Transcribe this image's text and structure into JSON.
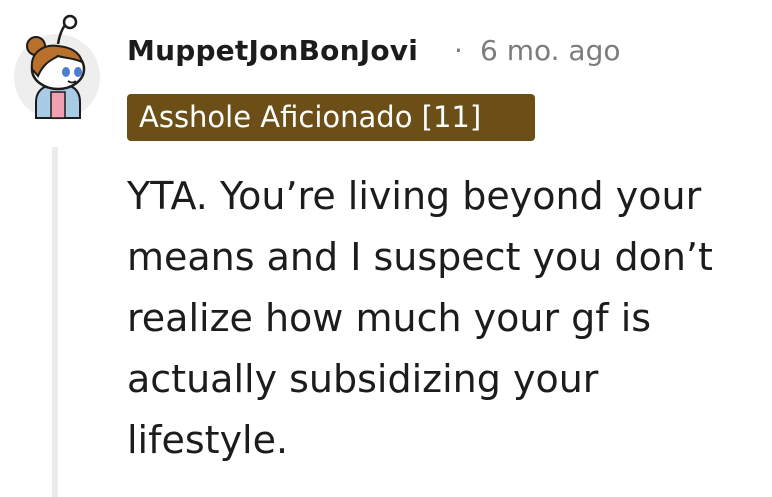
{
  "comment": {
    "username": "MuppetJonBonJovi",
    "separator": "·",
    "timestamp": "6 mo. ago",
    "flair": "Asshole Aficionado [11]",
    "body": "YTA. You’re living beyond your means and I suspect you don’t realize how much your gf is actually subsidizing your lifestyle.",
    "avatar_icon": "snoo-avatar-icon"
  },
  "colors": {
    "flair_bg": "#6b4f16",
    "flair_text": "#ffffff",
    "meta_text": "#7c7c7c",
    "thread_line": "#ececec"
  }
}
